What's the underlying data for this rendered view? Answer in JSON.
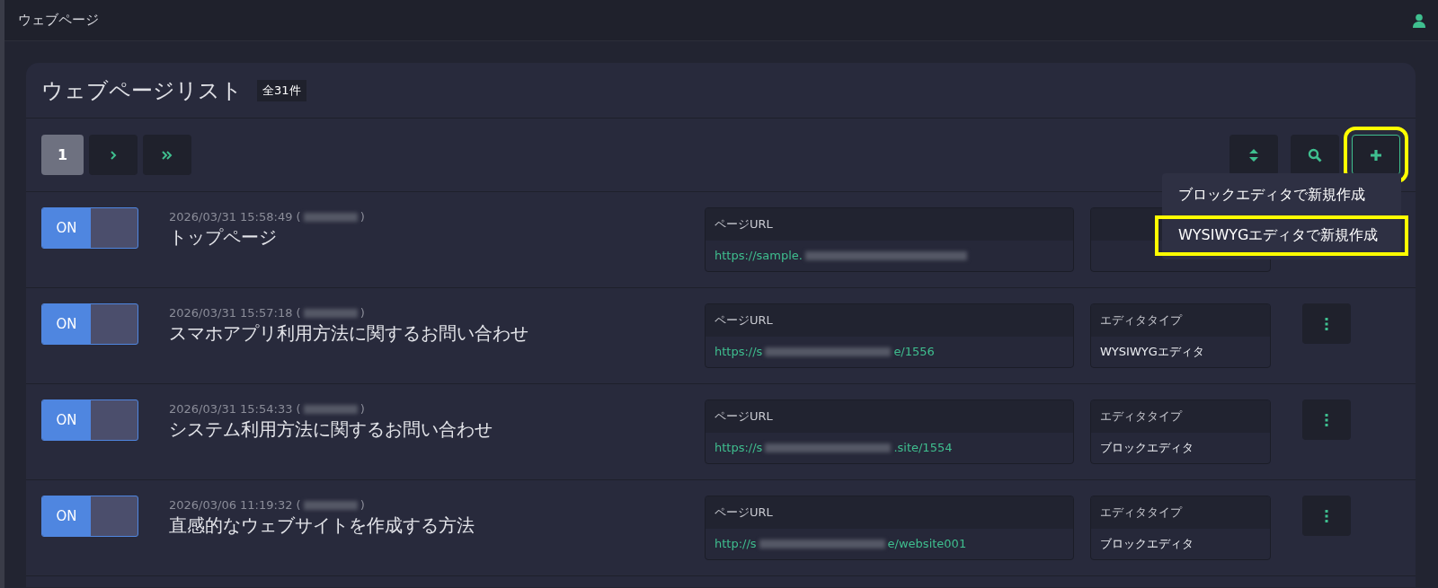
{
  "topbar": {
    "title": "ウェブページ"
  },
  "panel": {
    "title": "ウェブページリスト",
    "count": "全31件"
  },
  "pagination": [
    {
      "kind": "page",
      "label": "1",
      "selected": true
    },
    {
      "kind": "next",
      "selected": false
    },
    {
      "kind": "last",
      "selected": false
    }
  ],
  "toolbar": [
    {
      "kind": "sort",
      "highlighted": false
    },
    {
      "kind": "search",
      "highlighted": false
    },
    {
      "kind": "add",
      "highlighted": true
    }
  ],
  "add_menu": {
    "items": [
      {
        "label": "ブロックエディタで新規作成",
        "highlighted": false
      },
      {
        "label": "WYSIWYGエディタで新規作成",
        "highlighted": true
      }
    ]
  },
  "rows": [
    {
      "on": true,
      "toggle_label": "ON",
      "date": "2026/03/31 15:58:49 (",
      "date_end": ")",
      "title": "トップページ",
      "url_label": "ページURL",
      "url_start": "https://sample.",
      "url_end": ""
    },
    {
      "on": true,
      "toggle_label": "ON",
      "date": "2026/03/31 15:57:18 (",
      "date_end": ")",
      "title": "スマホアプリ利用方法に関するお問い合わせ",
      "url_label": "ページURL",
      "url_start": "https://s",
      "url_end": "e/1556",
      "editor_label": "エディタタイプ",
      "editor": "WYSIWYGエディタ"
    },
    {
      "on": true,
      "toggle_label": "ON",
      "date": "2026/03/31 15:54:33 (",
      "date_end": ")",
      "title": "システム利用方法に関するお問い合わせ",
      "url_label": "ページURL",
      "url_start": "https://s",
      "url_end": ".site/1554",
      "editor_label": "エディタタイプ",
      "editor": "ブロックエディタ"
    },
    {
      "on": true,
      "toggle_label": "ON",
      "date": "2026/03/06 11:19:32 (",
      "date_end": ")",
      "title": "直感的なウェブサイトを作成する方法",
      "url_label": "ページURL",
      "url_start": "http://s",
      "url_end": "e/website001",
      "editor_label": "エディタタイプ",
      "editor": "ブロックエディタ"
    }
  ]
}
